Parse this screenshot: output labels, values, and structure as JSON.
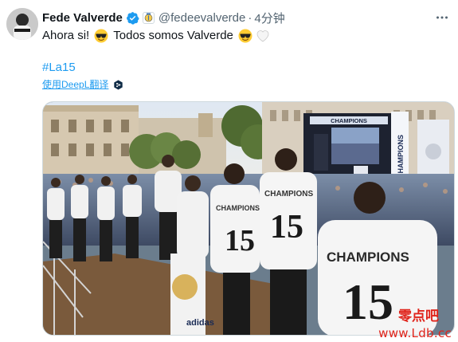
{
  "tweet": {
    "author_name": "Fede Valverde",
    "handle": "@fedeevalverde",
    "separator": "·",
    "time": "4分钟",
    "text_part1": "Ahora si! ",
    "text_part2": " Todos somos Valverde ",
    "hashtag": "#La15",
    "translate_label": "使用DeepL翻译"
  },
  "photo": {
    "screen_banner": "CHAMPIONS",
    "vertical_banner": "CHAMPIONS",
    "jersey_text": "CHAMPIONS",
    "jersey_number": "15",
    "sponsor": "adidas",
    "watermark_text": "零点吧"
  },
  "footer": {
    "watermark_url": "www.Ldb.cc"
  },
  "icons": {
    "verified": "verified-check-icon",
    "badge": "club-badge-icon",
    "more": "more-options-icon",
    "emoji_sunglasses": "sunglasses-emoji-icon",
    "emoji_heart": "white-heart-emoji-icon",
    "deepl": "deepl-icon"
  },
  "colors": {
    "link": "#1d9bf0",
    "text": "#0f1419",
    "muted": "#536471",
    "verified": "#1d9bf0",
    "watermark": "#e0241b"
  }
}
